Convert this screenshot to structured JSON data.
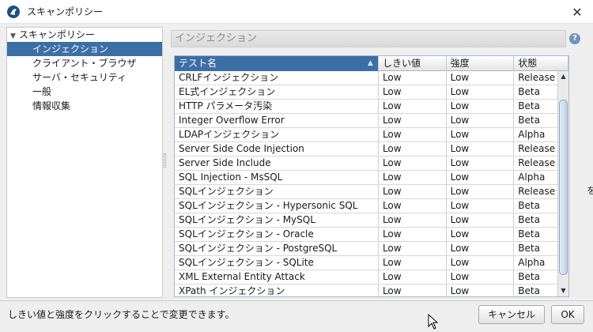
{
  "window": {
    "title": "スキャンポリシー"
  },
  "tree": {
    "root": "スキャンポリシー",
    "items": [
      {
        "label": "インジェクション",
        "selected": true
      },
      {
        "label": "クライアント・ブラウザ",
        "selected": false
      },
      {
        "label": "サーバ・セキュリティ",
        "selected": false
      },
      {
        "label": "一般",
        "selected": false
      },
      {
        "label": "情報収集",
        "selected": false
      }
    ]
  },
  "section": {
    "title": "インジェクション",
    "help_icon": "question-icon"
  },
  "table": {
    "headers": [
      "テスト名",
      "しきい値",
      "強度",
      "状態"
    ],
    "rows": [
      [
        "CRLFインジェクション",
        "Low",
        "Low",
        "Release"
      ],
      [
        "EL式インジェクション",
        "Low",
        "Low",
        "Beta"
      ],
      [
        "HTTP パラメータ汚染",
        "Low",
        "Low",
        "Beta"
      ],
      [
        "Integer Overflow Error",
        "Low",
        "Low",
        "Beta"
      ],
      [
        "LDAPインジェクション",
        "Low",
        "Low",
        "Alpha"
      ],
      [
        "Server Side Code Injection",
        "Low",
        "Low",
        "Release"
      ],
      [
        "Server Side Include",
        "Low",
        "Low",
        "Release"
      ],
      [
        "SQL Injection - MsSQL",
        "Low",
        "Low",
        "Alpha"
      ],
      [
        "SQLインジェクション",
        "Low",
        "Low",
        "Release"
      ],
      [
        "SQLインジェクション - Hypersonic SQL",
        "Low",
        "Low",
        "Beta"
      ],
      [
        "SQLインジェクション - MySQL",
        "Low",
        "Low",
        "Beta"
      ],
      [
        "SQLインジェクション - Oracle",
        "Low",
        "Low",
        "Beta"
      ],
      [
        "SQLインジェクション - PostgreSQL",
        "Low",
        "Low",
        "Beta"
      ],
      [
        "SQLインジェクション - SQLite",
        "Low",
        "Low",
        "Alpha"
      ],
      [
        "XML External Entity Attack",
        "Low",
        "Low",
        "Beta"
      ],
      [
        "XPath インジェクション",
        "Low",
        "Low",
        "Beta"
      ]
    ]
  },
  "footer": {
    "status": "しきい値と強度をクリックすることで変更できます。",
    "cancel_label": "キャンセル",
    "ok_label": "OK"
  },
  "background": {
    "glyph": "を"
  },
  "colors": {
    "selection": "#3c6fa6",
    "dialog_bg": "#eeeeee"
  }
}
